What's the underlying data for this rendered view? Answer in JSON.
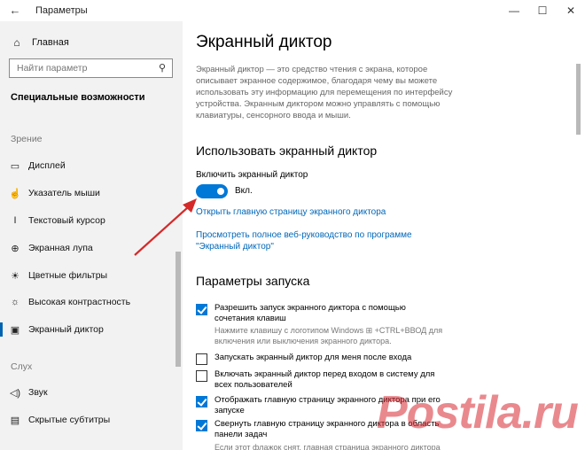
{
  "window": {
    "title": "Параметры",
    "back_icon": "←",
    "minimize_icon": "—",
    "maximize_icon": "☐",
    "close_icon": "✕"
  },
  "sidebar": {
    "home_label": "Главная",
    "home_icon": "⌂",
    "search_placeholder": "Найти параметр",
    "search_icon": "⚲",
    "section_title": "Специальные возможности",
    "group_vision": "Зрение",
    "group_hearing": "Слух",
    "items": [
      {
        "icon": "▭",
        "label": "Дисплей"
      },
      {
        "icon": "☝",
        "label": "Указатель мыши"
      },
      {
        "icon": "I",
        "label": "Текстовый курсор"
      },
      {
        "icon": "⊕",
        "label": "Экранная лупа"
      },
      {
        "icon": "☀",
        "label": "Цветные фильтры"
      },
      {
        "icon": "☼",
        "label": "Высокая контрастность"
      },
      {
        "icon": "▣",
        "label": "Экранный диктор"
      },
      {
        "icon": "◁)",
        "label": "Звук"
      },
      {
        "icon": "▤",
        "label": "Скрытые субтитры"
      }
    ]
  },
  "main": {
    "title": "Экранный диктор",
    "description": "Экранный диктор — это средство чтения с экрана, которое описывает экранное содержимое, благодаря чему вы можете использовать эту информацию для перемещения по интерфейсу устройства. Экранным диктором можно управлять с помощью клавиатуры, сенсорного ввода и мыши.",
    "use_heading": "Использовать экранный диктор",
    "toggle_label": "Включить экранный диктор",
    "toggle_state": "Вкл.",
    "toggle_on": true,
    "link_home": "Открыть главную страницу экранного диктора",
    "link_guide": "Просмотреть полное веб-руководство по программе \"Экранный диктор\"",
    "startup_heading": "Параметры запуска",
    "options": [
      {
        "checked": true,
        "label": "Разрешить запуск экранного диктора с помощью сочетания клавиш"
      },
      {
        "checked": false,
        "label": "Запускать экранный диктор для меня после входа"
      },
      {
        "checked": false,
        "label": "Включать экранный диктор перед входом в систему для всех пользователей"
      },
      {
        "checked": true,
        "label": "Отображать главную страницу экранного диктора при его запуске"
      },
      {
        "checked": true,
        "label": "Свернуть главную страницу экранного диктора в область панели задач"
      }
    ],
    "hint_shortcut": "Нажмите клавишу с логотипом Windows ⊞ +CTRL+ВВОД для включения или выключения экранного диктора.",
    "hint_cut": "Если этот флажок снят, главная страница экранного диктора будет"
  },
  "watermark": "Postila.ru",
  "colors": {
    "accent": "#0078d7",
    "link": "#0067b8",
    "sidebar_bg": "#f2f2f2",
    "arrow": "#d42a2a"
  }
}
